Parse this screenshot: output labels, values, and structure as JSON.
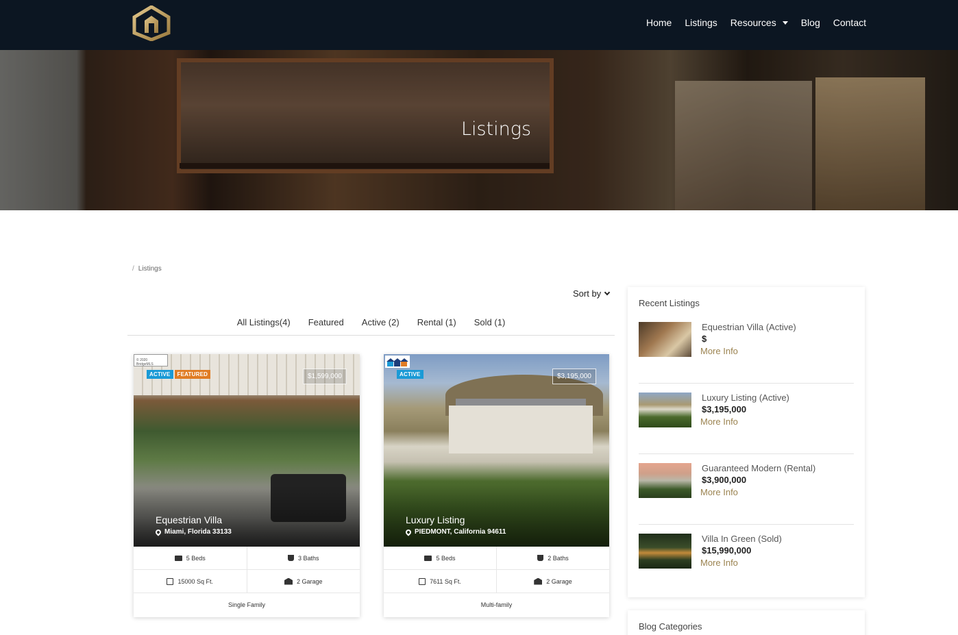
{
  "nav": {
    "items": [
      {
        "label": "Home"
      },
      {
        "label": "Listings"
      },
      {
        "label": "Resources"
      },
      {
        "label": "Blog"
      },
      {
        "label": "Contact"
      }
    ]
  },
  "hero": {
    "title": "Listings"
  },
  "breadcrumb": {
    "separator": "/",
    "current": "Listings"
  },
  "sort": {
    "label": "Sort by"
  },
  "filters": [
    "All Listings(4)",
    "Featured",
    "Active (2)",
    "Rental (1)",
    "Sold (1)"
  ],
  "colors": {
    "nav_bg": "#0c1622",
    "accent_gold": "#9b8350",
    "badge_active": "#1a9ad6",
    "badge_featured": "#e07c24"
  },
  "cards": [
    {
      "mls_label": "© 2020 BridgeMLS",
      "badges": [
        "ACTIVE",
        "FEATURED"
      ],
      "price": "$1,599,000",
      "title": "Equestrian Villa",
      "address": "Miami, Florida 33133",
      "beds": "5 Beds",
      "baths": "3 Baths",
      "area": "15000 Sq Ft.",
      "garage": "2 Garage",
      "type": "Single Family"
    },
    {
      "badges": [
        "ACTIVE"
      ],
      "price": "$3,195,000",
      "title": "Luxury Listing",
      "address": "PIEDMONT, California 94611",
      "beds": "5 Beds",
      "baths": "2 Baths",
      "area": "7611 Sq Ft.",
      "garage": "2 Garage",
      "type": "Multi-family"
    }
  ],
  "sidebar": {
    "title": "Recent Listings",
    "items": [
      {
        "name": "Equestrian Villa (Active)",
        "price": "$",
        "more": "More Info"
      },
      {
        "name": "Luxury Listing (Active)",
        "price": "$3,195,000",
        "more": "More Info"
      },
      {
        "name": "Guaranteed Modern (Rental)",
        "price": "$3,900,000",
        "more": "More Info"
      },
      {
        "name": "Villa In Green (Sold)",
        "price": "$15,990,000",
        "more": "More Info"
      }
    ],
    "blog_title": "Blog Categories"
  }
}
